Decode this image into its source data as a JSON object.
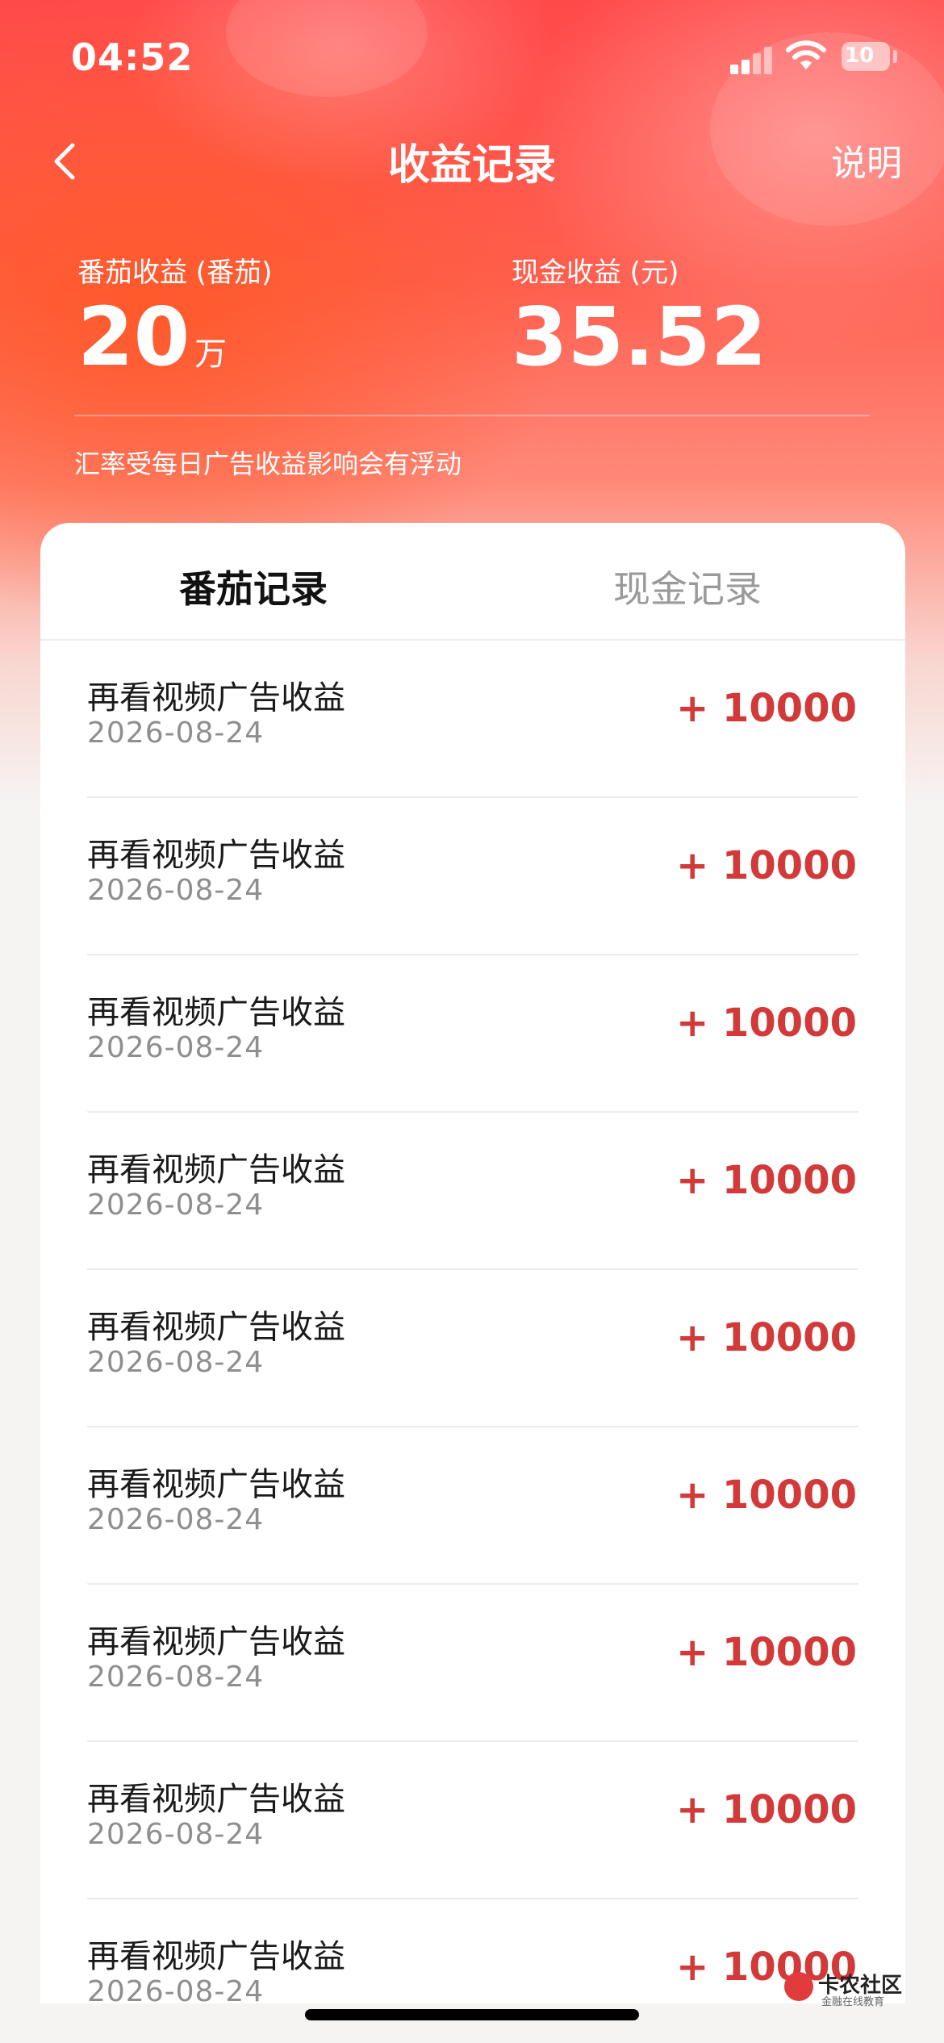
{
  "status_bar": {
    "time": "04:52",
    "battery": "10"
  },
  "nav": {
    "title": "收益记录",
    "help": "说明"
  },
  "stats": {
    "tomato": {
      "label": "番茄收益 (番茄)",
      "value": "20",
      "unit": "万"
    },
    "cash": {
      "label": "现金收益 (元)",
      "value": "35.52"
    }
  },
  "note": "汇率受每日广告收益影响会有浮动",
  "tabs": [
    {
      "label": "番茄记录",
      "active": true
    },
    {
      "label": "现金记录",
      "active": false
    }
  ],
  "records": [
    {
      "title": "再看视频广告收益",
      "date": "2026-08-24",
      "amount": "+ 10000"
    },
    {
      "title": "再看视频广告收益",
      "date": "2026-08-24",
      "amount": "+ 10000"
    },
    {
      "title": "再看视频广告收益",
      "date": "2026-08-24",
      "amount": "+ 10000"
    },
    {
      "title": "再看视频广告收益",
      "date": "2026-08-24",
      "amount": "+ 10000"
    },
    {
      "title": "再看视频广告收益",
      "date": "2026-08-24",
      "amount": "+ 10000"
    },
    {
      "title": "再看视频广告收益",
      "date": "2026-08-24",
      "amount": "+ 10000"
    },
    {
      "title": "再看视频广告收益",
      "date": "2026-08-24",
      "amount": "+ 10000"
    },
    {
      "title": "再看视频广告收益",
      "date": "2026-08-24",
      "amount": "+ 10000"
    },
    {
      "title": "再看视频广告收益",
      "date": "2026-08-24",
      "amount": "+ 10000"
    }
  ],
  "watermark": {
    "title": "卡农社区",
    "subtitle": "金融在线教育"
  },
  "colors": {
    "accent": "#ff4a4a",
    "amount": "#d23a3a"
  }
}
